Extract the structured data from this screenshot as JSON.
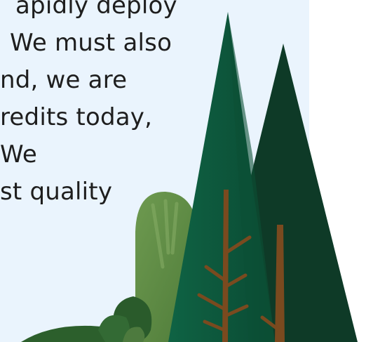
{
  "body_text": {
    "lines": [
      "apidly deploy",
      "We must also",
      "nd, we are",
      "redits today,",
      "We",
      "st quality"
    ]
  },
  "illustration": {
    "colors": {
      "panel_background": "#eaf4fd",
      "tree_dark": "#0f3d2a",
      "tree_mid": "#0e5b3d",
      "tree_trunk": "#7a4a1f",
      "bush_light": "#5f8c45",
      "bush_dark": "#2d5e2d"
    }
  }
}
